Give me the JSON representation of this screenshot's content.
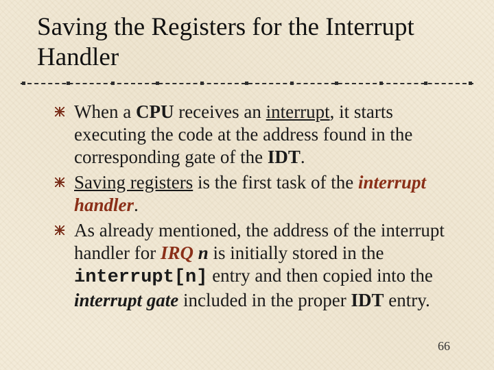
{
  "title": "Saving the Registers for the Interrupt Handler",
  "bullets": [
    {
      "pre": "When a ",
      "cpu": "CPU",
      "mid": " receives an ",
      "interrupt_u": "interrupt",
      "post1": ", it starts executing the code at the address found in the corresponding gate of the ",
      "idt": "IDT",
      "end": "."
    },
    {
      "saving": "Saving registers",
      "mid": " is the first task of the ",
      "ih": "interrupt handler",
      "end": "."
    },
    {
      "pre": "As already mentioned, the address of the interrupt handler for ",
      "irq": "IRQ",
      "space": " ",
      "n": "n",
      "mid1": " is initially stored in the ",
      "code": "interrupt[n]",
      "mid2": " entry and then copied into the ",
      "igate": "interrupt gate",
      "mid3": " included in the proper ",
      "idt": "IDT",
      "end": " entry."
    }
  ],
  "page_number": "66"
}
